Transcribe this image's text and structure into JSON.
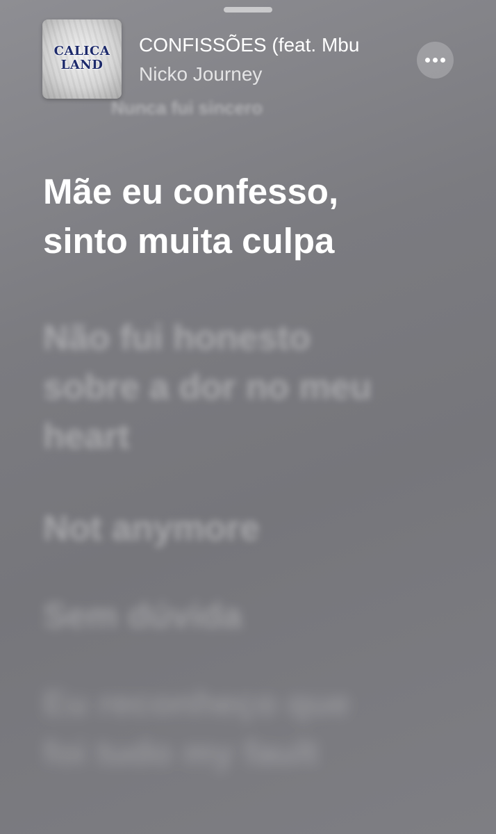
{
  "now_playing": {
    "title": "CONFISSÕES (feat. Mbu",
    "artist": "Nicko Journey",
    "artwork_text_line1": "CALICA",
    "artwork_text_line2": "LAND"
  },
  "lyrics": {
    "previous_line": "(previous lyric line, blurred)",
    "current": [
      "Mãe eu confesso,",
      "sinto muita culpa"
    ],
    "upcoming": [
      [
        "Não fui honesto",
        "sobre a dor no meu",
        "heart"
      ],
      [
        "Not anymore"
      ],
      [
        "Sem dúvida"
      ],
      [
        "Eu reconheço que",
        "foi tudo my fault"
      ]
    ]
  },
  "colors": {
    "background": "#7b7b80",
    "text_active": "#ffffff",
    "logo": "#1d2a6b"
  },
  "icons": {
    "more": "ellipsis-horizontal"
  }
}
